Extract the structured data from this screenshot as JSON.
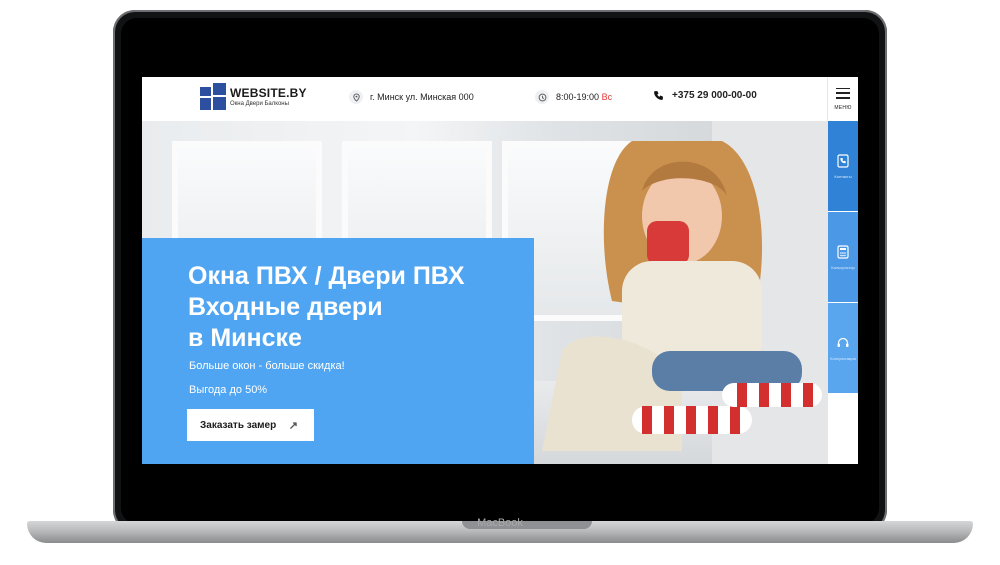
{
  "device": {
    "brand_label": "MacBook"
  },
  "header": {
    "logo_title": "WEBSITE.BY",
    "logo_subtitle": "Окна Двери Балконы",
    "address": "г. Минск ул. Минская 000",
    "hours": "8:00-19:00",
    "hours_suffix": "Вс",
    "phone": "+375 29 000-00-00",
    "menu_label": "МЕНЮ"
  },
  "hero": {
    "title_line1": "Окна ПВХ / Двери ПВХ",
    "title_line2": "Входные двери",
    "title_line3": "в Минске",
    "subtitle1": "Больше окон - больше скидка!",
    "subtitle2": "Выгода до 50%",
    "cta_label": "Заказать замер",
    "cta_icon": "arrow-up-right-icon"
  },
  "side_panel": {
    "items": [
      {
        "label": "Контакты",
        "icon": "phone-book-icon"
      },
      {
        "label": "Калькулятор",
        "icon": "calculator-icon"
      },
      {
        "label": "Консультация",
        "icon": "headset-icon"
      }
    ]
  },
  "colors": {
    "accent_blue": "#4fa5f2",
    "side_blue": "#2f82d6",
    "logo_blue": "#2c4fa0",
    "sunday_red": "#e53935"
  }
}
